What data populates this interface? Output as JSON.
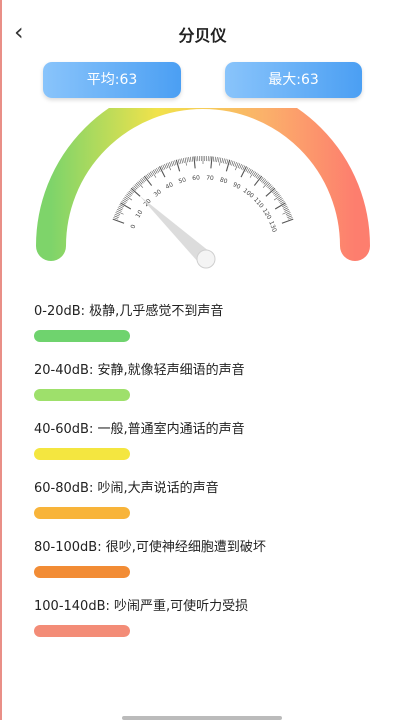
{
  "header": {
    "back_icon": "chevron-left-icon",
    "back_glyph": "‹",
    "title": "分贝仪"
  },
  "stats": {
    "average": "平均:63",
    "maximum": "最大:63"
  },
  "gauge": {
    "min": 0,
    "max": 130,
    "major_step": 10,
    "needle_value": 20,
    "ticks": [
      "0",
      "10",
      "20",
      "30",
      "40",
      "50",
      "60",
      "70",
      "80",
      "90",
      "100",
      "110",
      "120",
      "130"
    ],
    "colors": {
      "green": "#7ed46a",
      "yellow": "#f1e24b",
      "orange": "#fbb16a",
      "red": "#fd7e6e",
      "needle": "#dcdcdc"
    }
  },
  "levels": [
    {
      "label": "0-20dB: 极静,几乎感觉不到声音",
      "color": "#6fd36e"
    },
    {
      "label": "20-40dB: 安静,就像轻声细语的声音",
      "color": "#9ee06b"
    },
    {
      "label": "40-60dB: 一般,普通室内通话的声音",
      "color": "#f4e640"
    },
    {
      "label": "60-80dB: 吵闹,大声说话的声音",
      "color": "#f8b43a"
    },
    {
      "label": "80-100dB: 很吵,可使神经细胞遭到破坏",
      "color": "#f28c35"
    },
    {
      "label": "100-140dB: 吵闹严重,可使听力受损",
      "color": "#f38c77"
    }
  ]
}
